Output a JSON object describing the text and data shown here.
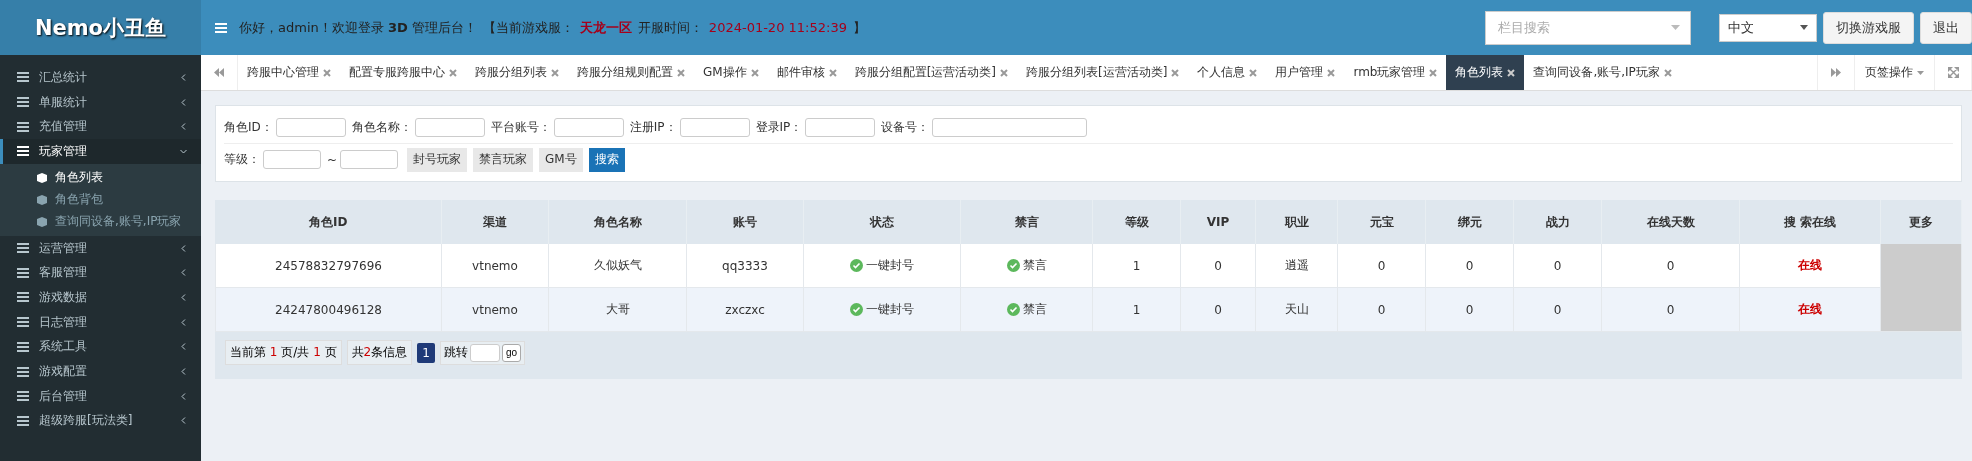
{
  "logo": {
    "text": "Nemo小丑鱼"
  },
  "topbar": {
    "greeting": "你好，admin！欢迎登录 **3D** 管理后台！",
    "server_label": "【当前游戏服：",
    "server_name": "天龙一区",
    "open_label": "开服时间：",
    "open_time": "2024-01-20 11:52:39",
    "bracket_close": "】",
    "search": {
      "placeholder": "栏目搜索"
    },
    "language": "中文",
    "buttons": [
      "切换游戏服",
      "退出"
    ]
  },
  "sidebar": {
    "items": [
      {
        "label": "汇总统计",
        "expanded": false
      },
      {
        "label": "单服统计",
        "expanded": false
      },
      {
        "label": "充值管理",
        "expanded": false
      },
      {
        "label": "玩家管理",
        "expanded": true,
        "children": [
          {
            "label": "角色列表",
            "selected": true
          },
          {
            "label": "角色背包",
            "selected": false
          },
          {
            "label": "查询同设备,账号,IP玩家",
            "selected": false
          }
        ]
      },
      {
        "label": "运营管理",
        "expanded": false
      },
      {
        "label": "客服管理",
        "expanded": false
      },
      {
        "label": "游戏数据",
        "expanded": false
      },
      {
        "label": "日志管理",
        "expanded": false
      },
      {
        "label": "系统工具",
        "expanded": false
      },
      {
        "label": "游戏配置",
        "expanded": false
      },
      {
        "label": "后台管理",
        "expanded": false
      },
      {
        "label": "超级跨服[玩法类]",
        "expanded": false
      }
    ]
  },
  "tabs": {
    "items": [
      {
        "label": "跨服中心管理",
        "selected": false
      },
      {
        "label": "配置专服跨服中心",
        "selected": false
      },
      {
        "label": "跨服分组列表",
        "selected": false
      },
      {
        "label": "跨服分组规则配置",
        "selected": false
      },
      {
        "label": "GM操作",
        "selected": false
      },
      {
        "label": "邮件审核",
        "selected": false
      },
      {
        "label": "跨服分组配置[运营活动类]",
        "selected": false
      },
      {
        "label": "跨服分组列表[运营活动类]",
        "selected": false
      },
      {
        "label": "个人信息",
        "selected": false
      },
      {
        "label": "用户管理",
        "selected": false
      },
      {
        "label": "rmb玩家管理",
        "selected": false
      },
      {
        "label": "角色列表",
        "selected": true
      },
      {
        "label": "查询同设备,账号,IP玩家",
        "selected": false
      }
    ],
    "menu_label": "页签操作"
  },
  "filters": {
    "fields": [
      {
        "label": "角色ID：",
        "kind": "normal"
      },
      {
        "label": "角色名称：",
        "kind": "normal"
      },
      {
        "label": "平台账号：",
        "kind": "normal"
      },
      {
        "label": "注册IP：",
        "kind": "normal"
      },
      {
        "label": "登录IP：",
        "kind": "normal"
      },
      {
        "label": "设备号：",
        "kind": "wide"
      }
    ],
    "level_label": "等级：",
    "range_sep": "~",
    "buttons": [
      {
        "label": "封号玩家",
        "kind": "default"
      },
      {
        "label": "禁言玩家",
        "kind": "default"
      },
      {
        "label": "GM号",
        "kind": "default"
      },
      {
        "label": "搜索",
        "kind": "primary"
      }
    ]
  },
  "table": {
    "columns": [
      "角色ID",
      "渠道",
      "角色名称",
      "账号",
      "状态",
      "禁言",
      "等级",
      "VIP",
      "职业",
      "元宝",
      "绑元",
      "战力",
      "在线天数",
      "搜 索在线",
      "更多"
    ],
    "rows": [
      {
        "cells": [
          "24578832797696",
          "vtnemo",
          "久似妖气",
          "qq3333",
          "一键封号",
          "禁言",
          "1",
          "0",
          "逍遥",
          "0",
          "0",
          "0",
          "0",
          "在线"
        ]
      },
      {
        "cells": [
          "24247800496128",
          "vtnemo",
          "大哥",
          "zxczxc",
          "一键封号",
          "禁言",
          "1",
          "0",
          "天山",
          "0",
          "0",
          "0",
          "0",
          "在线"
        ]
      }
    ]
  },
  "pager": {
    "page_info": [
      "当前第 ",
      "1",
      " 页/共 ",
      "1",
      " 页"
    ],
    "count_info": [
      "共",
      "2",
      "条信息"
    ],
    "pages": [
      {
        "label": "1",
        "selected": true
      }
    ],
    "jump_label": "跳转",
    "go": "go"
  }
}
